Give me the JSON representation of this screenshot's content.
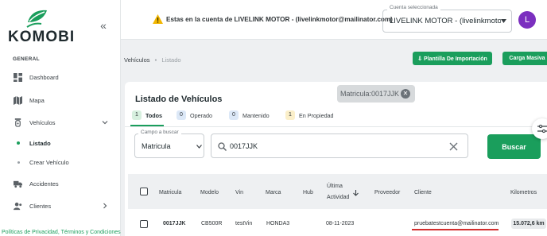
{
  "brand": {
    "name": "KOMOBI",
    "accent": "#1a9e5c"
  },
  "sidebar": {
    "section": "GENERAL",
    "items": [
      {
        "label": "Dashboard",
        "icon": "dashboard-icon"
      },
      {
        "label": "Mapa",
        "icon": "map-icon"
      },
      {
        "label": "Vehículos",
        "icon": "vehicle-icon",
        "expanded": true
      },
      {
        "label": "Accidentes",
        "icon": "truck-icon"
      },
      {
        "label": "Clientes",
        "icon": "clients-icon"
      }
    ],
    "subitems": [
      {
        "label": "Listado",
        "active": true
      },
      {
        "label": "Crear Vehículo",
        "active": false
      }
    ],
    "footer_link": "Políticas de Privacidad, Términos y Condiciones"
  },
  "topbar": {
    "warning": "Estas en la cuenta de LIVELINK MOTOR - (livelinkmotor@mailinator.com)",
    "account_caption": "Cuenta seleccionada",
    "account_value": "LIVELINK MOTOR - (livelinkmotor@mailinator.com)",
    "avatar_initial": "L",
    "avatar_color": "#7b2fbf"
  },
  "breadcrumb": {
    "parent": "Vehículos",
    "separator": "•",
    "current": "Listado"
  },
  "actions": {
    "template": "⇩ Plantilla De Importación",
    "bulk": "Carga Masiva"
  },
  "main": {
    "title": "Listado de Vehículos",
    "filter_chip": "Matricula:0017JJK",
    "tabs": [
      {
        "count": "1",
        "label": "Todos",
        "color": "#d7f0df"
      },
      {
        "count": "0",
        "label": "Operado",
        "color": "#dce8f7"
      },
      {
        "count": "0",
        "label": "Mantenido",
        "color": "#dce8f7"
      },
      {
        "count": "1",
        "label": "En Propiedad",
        "color": "#fbefc9"
      }
    ],
    "search": {
      "field_caption": "Campo a buscar",
      "field_value": "Matricula",
      "query": "0017JJK",
      "button": "Buscar"
    },
    "table": {
      "headers": [
        "Matricula",
        "Modelo",
        "Vin",
        "Marca",
        "Hub",
        "Última",
        "Actividad",
        "Proveedor",
        "Cliente",
        "Kilometros"
      ],
      "rows": [
        {
          "matricula": "0017JJK",
          "modelo": "CB500R",
          "vin": "testVin",
          "marca": "HONDA3",
          "hub": "",
          "actividad": "08-11-2023",
          "proveedor": "",
          "cliente": "pruebatestcuenta@mailinator.com",
          "km": "15.072,6 km"
        }
      ]
    }
  }
}
